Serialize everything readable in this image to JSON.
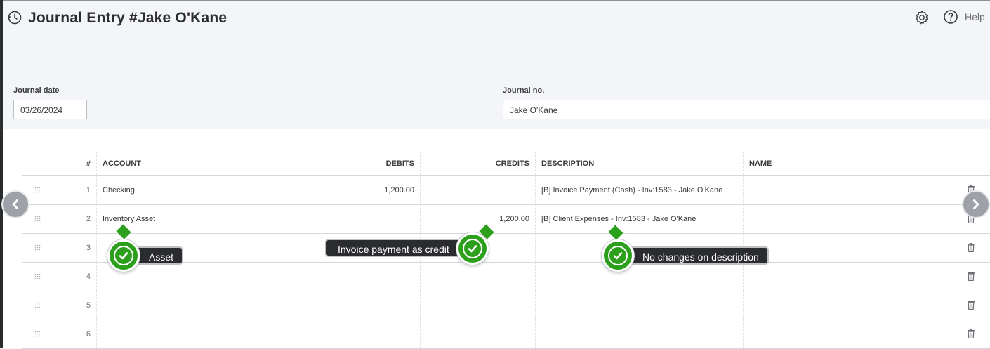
{
  "header": {
    "title": "Journal Entry #Jake O'Kane",
    "help_label": "Help"
  },
  "form": {
    "journal_date_label": "Journal date",
    "journal_date_value": "03/26/2024",
    "journal_no_label": "Journal no.",
    "journal_no_value": "Jake O'Kane"
  },
  "table": {
    "columns": {
      "num": "#",
      "account": "ACCOUNT",
      "debits": "DEBITS",
      "credits": "CREDITS",
      "description": "DESCRIPTION",
      "name": "NAME"
    },
    "rows": [
      {
        "num": "1",
        "account": "Checking",
        "debits": "1,200.00",
        "credits": "",
        "description": "[B] Invoice Payment (Cash) - Inv:1583 - Jake O'Kane",
        "name": ""
      },
      {
        "num": "2",
        "account": "Inventory Asset",
        "debits": "",
        "credits": "1,200.00",
        "description": "[B] Client Expenses - Inv:1583 - Jake O'Kane",
        "name": ""
      },
      {
        "num": "3",
        "account": "",
        "debits": "",
        "credits": "",
        "description": "",
        "name": ""
      },
      {
        "num": "4",
        "account": "",
        "debits": "",
        "credits": "",
        "description": "",
        "name": ""
      },
      {
        "num": "5",
        "account": "",
        "debits": "",
        "credits": "",
        "description": "",
        "name": ""
      },
      {
        "num": "6",
        "account": "",
        "debits": "",
        "credits": "",
        "description": "",
        "name": ""
      }
    ]
  },
  "callouts": {
    "asset": "Asset",
    "credit": "Invoice payment as credit",
    "description": "No changes on description"
  },
  "colors": {
    "check_green": "#2ca01c",
    "callout_bg": "#2b2c2f"
  }
}
